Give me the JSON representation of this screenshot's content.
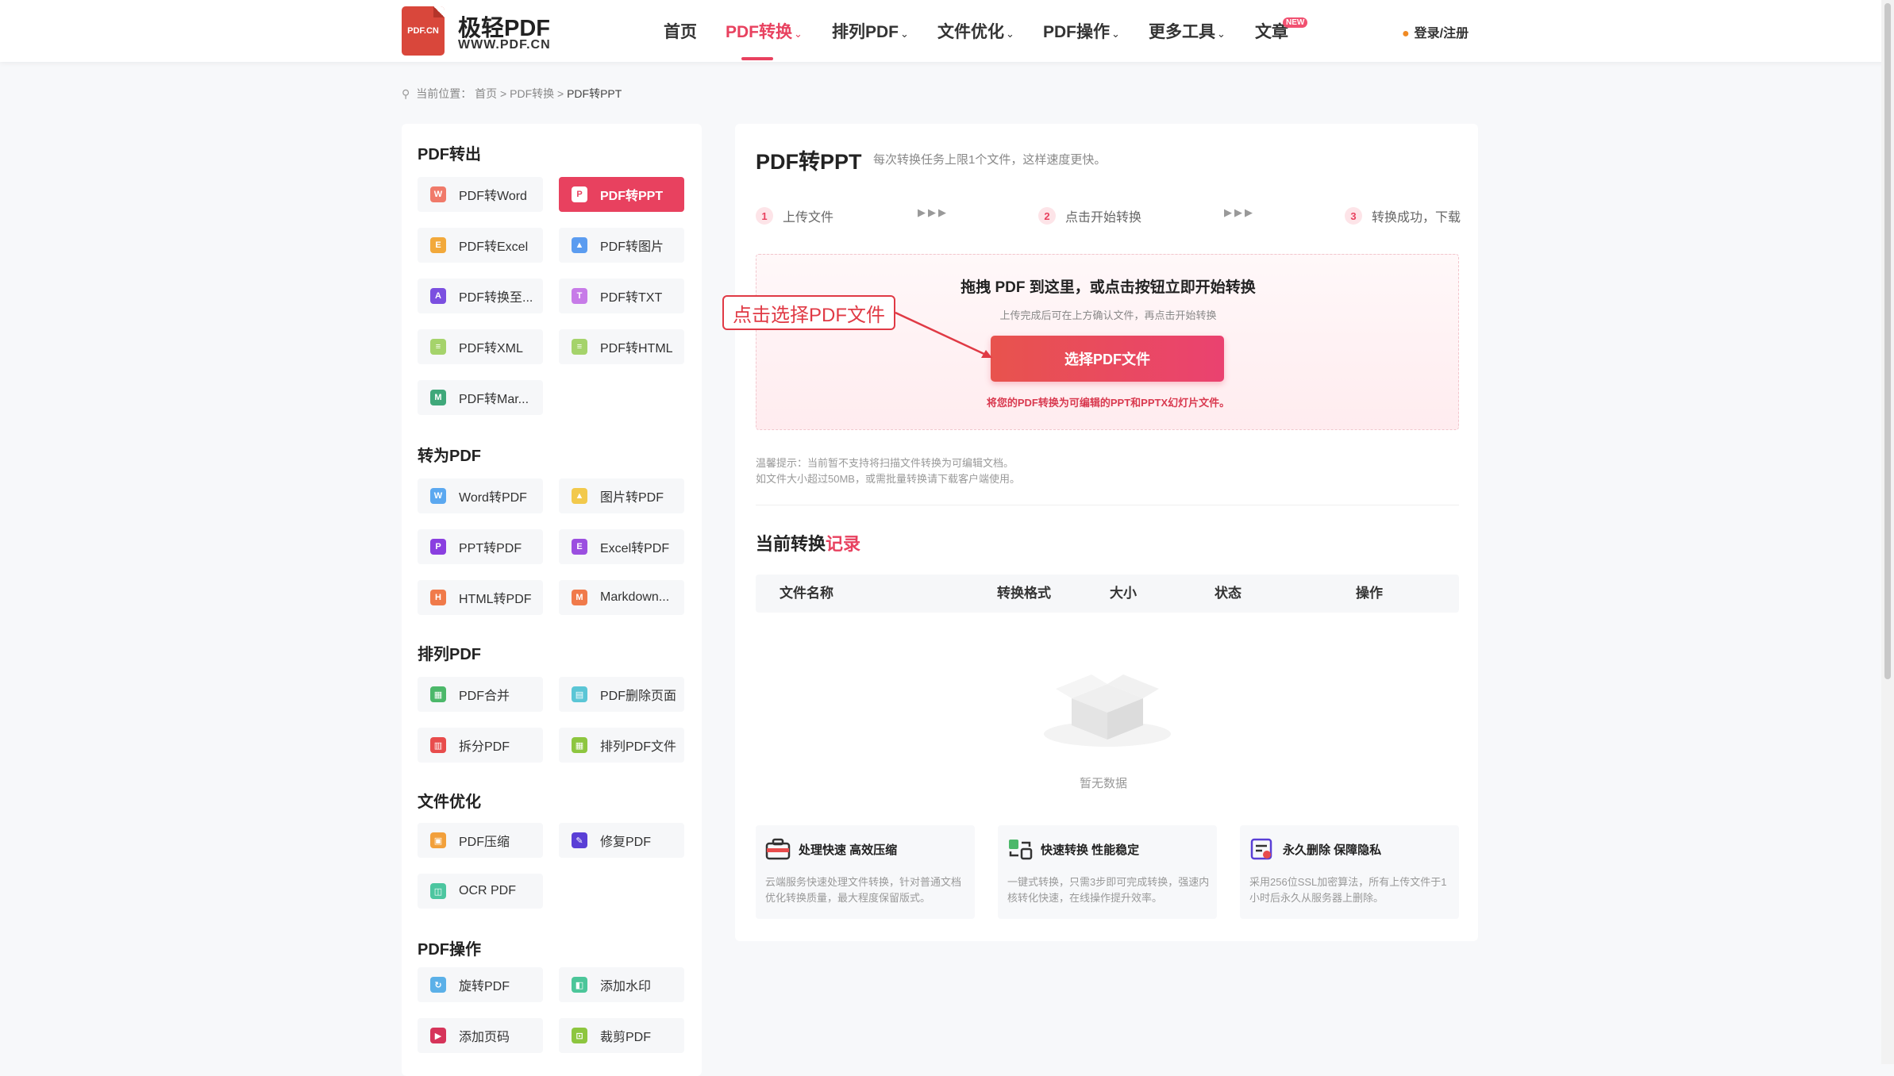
{
  "header": {
    "logo_badge": "PDF.CN",
    "logo_title": "极轻PDF",
    "logo_sub": "WWW.PDF.CN",
    "nav": [
      {
        "label": "首页",
        "dropdown": false,
        "active": false
      },
      {
        "label": "PDF转换",
        "dropdown": true,
        "active": true
      },
      {
        "label": "排列PDF",
        "dropdown": true,
        "active": false
      },
      {
        "label": "文件优化",
        "dropdown": true,
        "active": false
      },
      {
        "label": "PDF操作",
        "dropdown": true,
        "active": false
      },
      {
        "label": "更多工具",
        "dropdown": true,
        "active": false
      },
      {
        "label": "文章",
        "dropdown": false,
        "active": false
      }
    ],
    "new_badge": "NEW",
    "login": "登录/注册",
    "chevron": "⌄"
  },
  "breadcrumb": {
    "prefix": "当前位置：",
    "home": "首页",
    "sep": ">",
    "section": "PDF转换",
    "current": "PDF转PPT"
  },
  "sidebar": {
    "groups": [
      {
        "title": "PDF转出",
        "items": [
          {
            "label": "PDF转Word",
            "icon": "W",
            "color": "#f07a6a"
          },
          {
            "label": "PDF转PPT",
            "icon": "P",
            "color": "#8dc63f",
            "active": true
          },
          {
            "label": "PDF转Excel",
            "icon": "E",
            "color": "#f2a93b"
          },
          {
            "label": "PDF转图片",
            "icon": "▲",
            "color": "#5b9cf0"
          },
          {
            "label": "PDF转换至...",
            "icon": "A",
            "color": "#7b4fe0"
          },
          {
            "label": "PDF转TXT",
            "icon": "T",
            "color": "#c77be8"
          },
          {
            "label": "PDF转XML",
            "icon": "≡",
            "color": "#a5d36b"
          },
          {
            "label": "PDF转HTML",
            "icon": "≡",
            "color": "#a5d36b"
          },
          {
            "label": "PDF转Mar...",
            "icon": "M",
            "color": "#3fa87a"
          }
        ]
      },
      {
        "title": "转为PDF",
        "items": [
          {
            "label": "Word转PDF",
            "icon": "W",
            "color": "#5ba8f0"
          },
          {
            "label": "图片转PDF",
            "icon": "▲",
            "color": "#f2c94c"
          },
          {
            "label": "PPT转PDF",
            "icon": "P",
            "color": "#8a3fe0"
          },
          {
            "label": "Excel转PDF",
            "icon": "E",
            "color": "#9b4fe0"
          },
          {
            "label": "HTML转PDF",
            "icon": "H",
            "color": "#f07a4a"
          },
          {
            "label": "Markdown...",
            "icon": "M",
            "color": "#f07a4a"
          }
        ]
      },
      {
        "title": "排列PDF",
        "items": [
          {
            "label": "PDF合并",
            "icon": "▦",
            "color": "#4cb86a"
          },
          {
            "label": "PDF删除页面",
            "icon": "▤",
            "color": "#5bc6d6"
          },
          {
            "label": "拆分PDF",
            "icon": "▥",
            "color": "#e84c4c"
          },
          {
            "label": "排列PDF文件",
            "icon": "▦",
            "color": "#8dc63f"
          }
        ]
      },
      {
        "title": "文件优化",
        "items": [
          {
            "label": "PDF压缩",
            "icon": "▣",
            "color": "#f2a03b"
          },
          {
            "label": "修复PDF",
            "icon": "✎",
            "color": "#5a3fd6"
          },
          {
            "label": "OCR PDF",
            "icon": "◫",
            "color": "#4cc6a0"
          }
        ]
      },
      {
        "title": "PDF操作",
        "items": [
          {
            "label": "旋转PDF",
            "icon": "↻",
            "color": "#5bb0e8"
          },
          {
            "label": "添加水印",
            "icon": "◧",
            "color": "#4cc69a"
          },
          {
            "label": "添加页码",
            "icon": "▶",
            "color": "#d6345a"
          },
          {
            "label": "裁剪PDF",
            "icon": "⊡",
            "color": "#8dc63f"
          }
        ]
      }
    ]
  },
  "main": {
    "title": "PDF转PPT",
    "tip": "每次转换任务上限1个文件，这样速度更快。",
    "steps": [
      {
        "num": "1",
        "label": "上传文件"
      },
      {
        "num": "2",
        "label": "点击开始转换"
      },
      {
        "num": "3",
        "label": "转换成功，下载"
      }
    ],
    "step_arrow": "▶▶▶",
    "dropzone": {
      "title": "拖拽 PDF 到这里，或点击按钮立即开始转换",
      "subtitle": "上传完成后可在上方确认文件，再点击开始转换",
      "button": "选择PDF文件",
      "note": "将您的PDF转换为可编辑的PPT和PPTX幻灯片文件。"
    },
    "annotation": "点击选择PDF文件",
    "hints": [
      "温馨提示：当前暂不支持将扫描文件转换为可编辑文档。",
      "如文件大小超过50MB，或需批量转换请下载客户端使用。"
    ],
    "records": {
      "title_prefix": "当前转换",
      "title_highlight": "记录",
      "columns": [
        "文件名称",
        "转换格式",
        "大小",
        "状态",
        "操作"
      ],
      "empty": "暂无数据"
    },
    "features": [
      {
        "title": "处理快速 高效压缩",
        "desc": "云端服务快速处理文件转换，针对普通文档优化转换质量，最大程度保留版式。",
        "icon": "briefcase-icon"
      },
      {
        "title": "快速转换 性能稳定",
        "desc": "一键式转换，只需3步即可完成转换，强速内核转化快速，在线操作提升效率。",
        "icon": "convert-icon"
      },
      {
        "title": "永久删除 保障隐私",
        "desc": "采用256位SSL加密算法，所有上传文件于1小时后永久从服务器上删除。",
        "icon": "privacy-icon"
      }
    ]
  },
  "colors": {
    "accent": "#e8415f",
    "annotation": "#e03a45"
  }
}
